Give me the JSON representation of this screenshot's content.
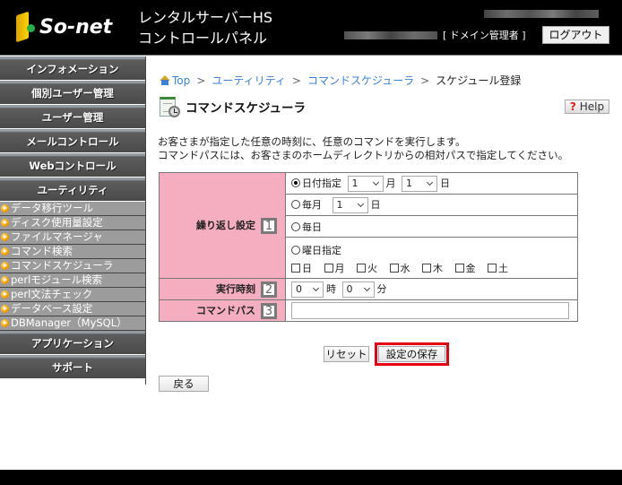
{
  "header": {
    "logo_text": "So-net",
    "title_line1": "レンタルサーバーHS",
    "title_line2": "コントロールパネル",
    "user_role": "[ ドメイン管理者 ]",
    "logout_label": "ログアウト"
  },
  "sidebar": {
    "categories_top": [
      {
        "label": "インフォメーション"
      },
      {
        "label": "個別ユーザー管理"
      },
      {
        "label": "ユーザー管理"
      },
      {
        "label": "メールコントロール"
      },
      {
        "label": "Webコントロール"
      },
      {
        "label": "ユーティリティ"
      }
    ],
    "utility_items": [
      {
        "label": "データ移行ツール"
      },
      {
        "label": "ディスク使用量設定"
      },
      {
        "label": "ファイルマネージャ"
      },
      {
        "label": "コマンド検索"
      },
      {
        "label": "コマンドスケジューラ"
      },
      {
        "label": "perlモジュール検索"
      },
      {
        "label": "perl文法チェック"
      },
      {
        "label": "データベース設定"
      },
      {
        "label": "DBManager（MySQL）"
      }
    ],
    "categories_bottom": [
      {
        "label": "アプリケーション"
      },
      {
        "label": "サポート"
      }
    ]
  },
  "breadcrumb": {
    "items": [
      "Top",
      "ユーティリティ",
      "コマンドスケジューラ"
    ],
    "current": "スケジュール登録",
    "separator": ">"
  },
  "page": {
    "title": "コマンドスケジューラ",
    "help_label": "Help",
    "help_icon": "?",
    "description_line1": "お客さまが指定した任意の時刻に、任意のコマンドを実行します。",
    "description_line2": "コマンドパスには、お客さまのホームディレクトリからの相対パスで指定してください。"
  },
  "form": {
    "repeat": {
      "label": "繰り返し設定",
      "step": "1",
      "date_option": {
        "label": "日付指定",
        "checked": true,
        "month_value": "1",
        "month_unit": "月",
        "day_value": "1",
        "day_unit": "日"
      },
      "monthly_option": {
        "label": "毎月",
        "checked": false,
        "day_value": "1",
        "day_unit": "日"
      },
      "daily_option": {
        "label": "毎日",
        "checked": false
      },
      "weekday_option": {
        "label": "曜日指定",
        "checked": false,
        "days": [
          "日",
          "月",
          "火",
          "水",
          "木",
          "金",
          "土"
        ]
      }
    },
    "time": {
      "label": "実行時刻",
      "step": "2",
      "hour_value": "0",
      "hour_unit": "時",
      "minute_value": "0",
      "minute_unit": "分"
    },
    "path": {
      "label": "コマンドパス",
      "step": "3",
      "value": ""
    },
    "reset_label": "リセット",
    "save_label": "設定の保存",
    "back_label": "戻る"
  },
  "colors": {
    "label_bg": "#f5aec0",
    "highlight": "#e60012",
    "link": "#3a82d6"
  }
}
